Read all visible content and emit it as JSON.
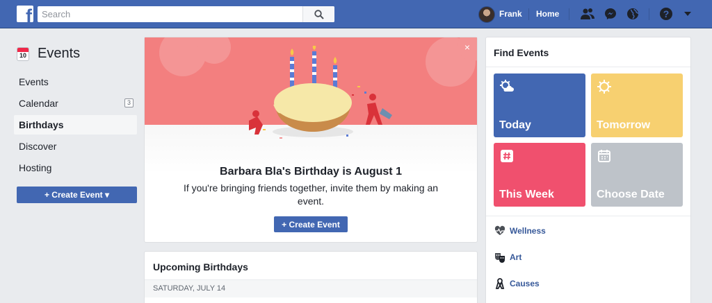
{
  "topbar": {
    "logo": "f",
    "search_placeholder": "Search",
    "user_name": "Frank",
    "home": "Home",
    "icons": [
      "friends-icon",
      "messenger-icon",
      "globe-icon",
      "help-icon",
      "caret-down-icon"
    ]
  },
  "sidebar": {
    "calendar_day": "10",
    "title": "Events",
    "items": [
      {
        "label": "Events"
      },
      {
        "label": "Calendar",
        "badge": "3"
      },
      {
        "label": "Birthdays",
        "active": true
      },
      {
        "label": "Discover"
      },
      {
        "label": "Hosting"
      }
    ],
    "create_label": "+ Create Event ▾"
  },
  "birthday": {
    "title": "Barbara Bla's Birthday is August 1",
    "body": "If you're bringing friends together, invite them by making an event.",
    "create_label": "+ Create Event",
    "close": "×"
  },
  "upcoming": {
    "title": "Upcoming Birthdays",
    "date": "SATURDAY, JULY 14"
  },
  "find_events": {
    "title": "Find Events",
    "tiles": [
      {
        "label": "Today",
        "color": "#4267b2",
        "icon": "sun-cloud-icon"
      },
      {
        "label": "Tomorrow",
        "color": "#f7d070",
        "icon": "sun-icon"
      },
      {
        "label": "This Week",
        "color": "#f0506e",
        "icon": "hashtag-icon"
      },
      {
        "label": "Choose Date",
        "color": "#bec3c9",
        "icon": "calendar-icon"
      }
    ],
    "categories": [
      {
        "label": "Wellness",
        "icon": "heartbeat-icon"
      },
      {
        "label": "Art",
        "icon": "theater-masks-icon"
      },
      {
        "label": "Causes",
        "icon": "ribbon-icon"
      }
    ]
  },
  "colors": {
    "brand": "#4267b2",
    "link": "#365899",
    "hero": "#f37f7f"
  }
}
